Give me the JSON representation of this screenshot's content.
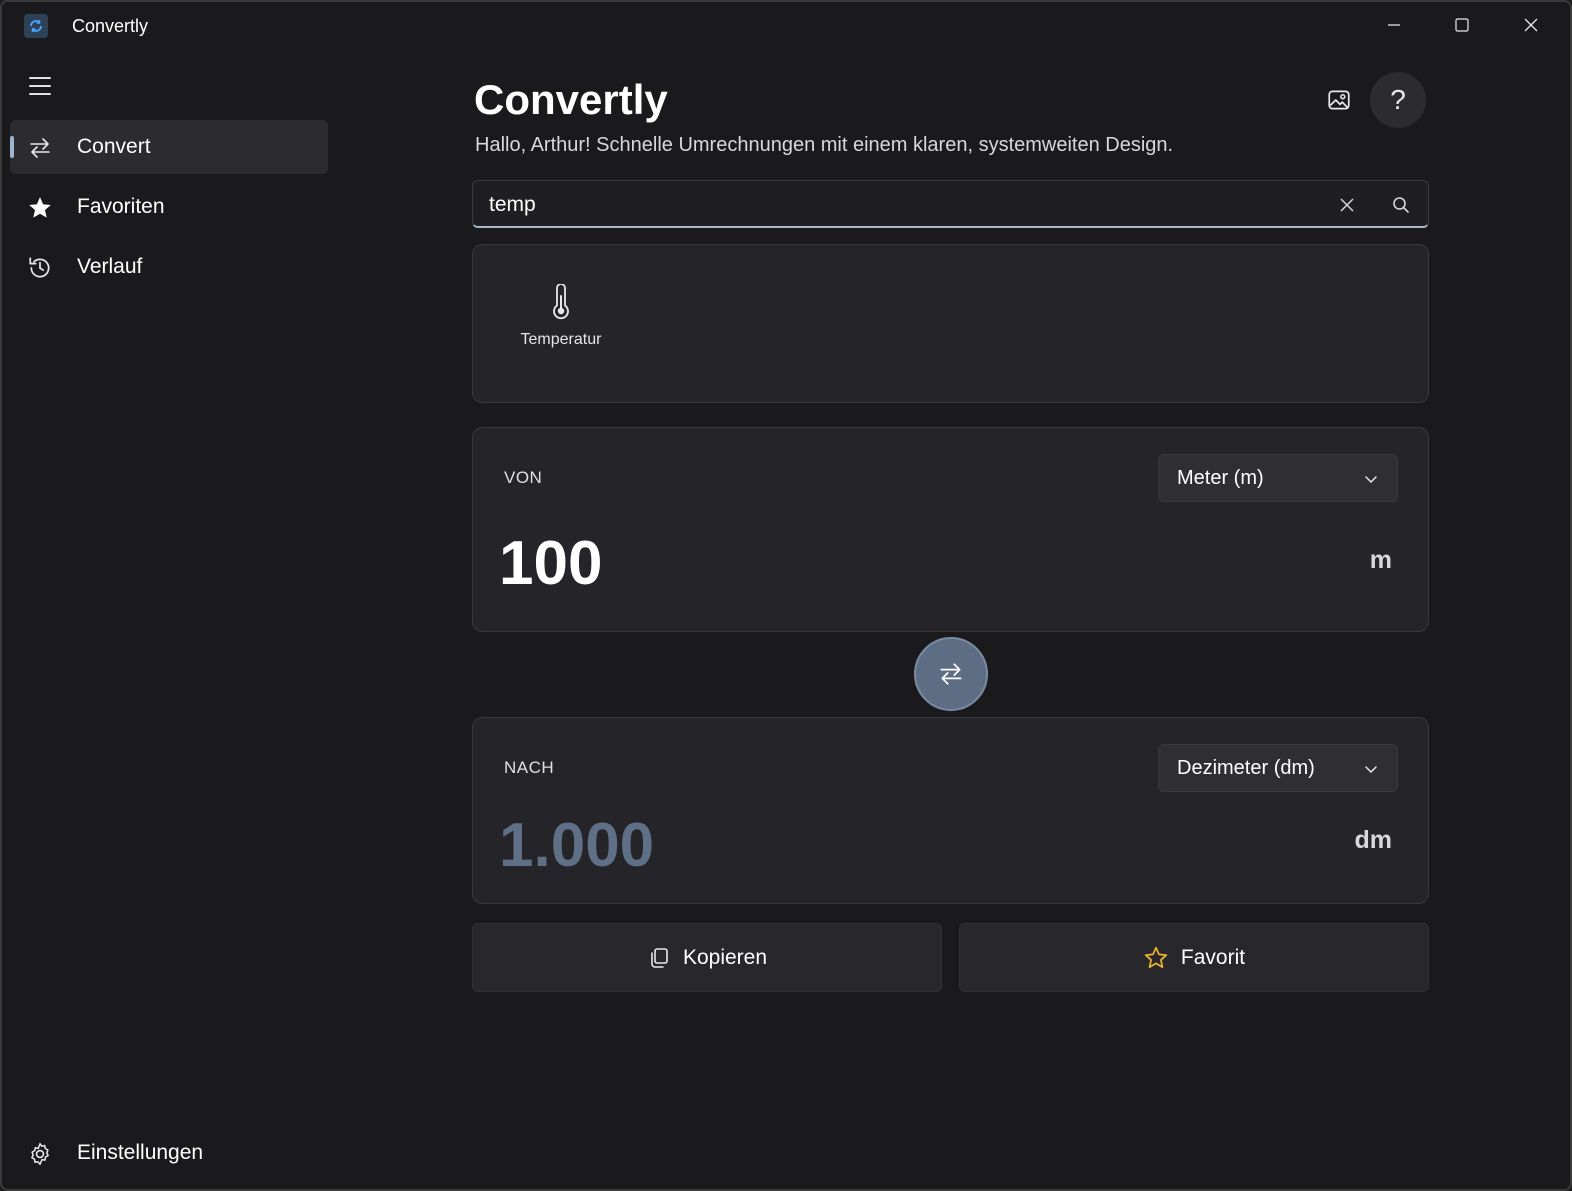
{
  "window": {
    "title": "Convertly"
  },
  "sidebar": {
    "items": [
      {
        "label": "Convert",
        "icon": "swap-arrows-icon",
        "active": true
      },
      {
        "label": "Favoriten",
        "icon": "star-icon",
        "active": false
      },
      {
        "label": "Verlauf",
        "icon": "history-icon",
        "active": false
      }
    ],
    "settings_label": "Einstellungen"
  },
  "header": {
    "title": "Convertly",
    "subtitle": "Hallo, Arthur! Schnelle Umrechnungen mit einem klaren, systemweiten Design."
  },
  "search": {
    "value": "temp"
  },
  "categories": [
    {
      "label": "Temperatur",
      "icon": "thermometer-icon"
    }
  ],
  "from": {
    "label": "VON",
    "unit_select": "Meter (m)",
    "value": "100",
    "unit_suffix": "m"
  },
  "to": {
    "label": "NACH",
    "unit_select": "Dezimeter (dm)",
    "value": "1.000",
    "unit_suffix": "dm"
  },
  "actions": {
    "copy_label": "Kopieren",
    "favorite_label": "Favorit"
  },
  "colors": {
    "accent": "#5d6d84",
    "result_value": "#5f6f86",
    "favorite_star": "#e8b12e",
    "background": "#1a1a1d",
    "panel": "#252529"
  }
}
